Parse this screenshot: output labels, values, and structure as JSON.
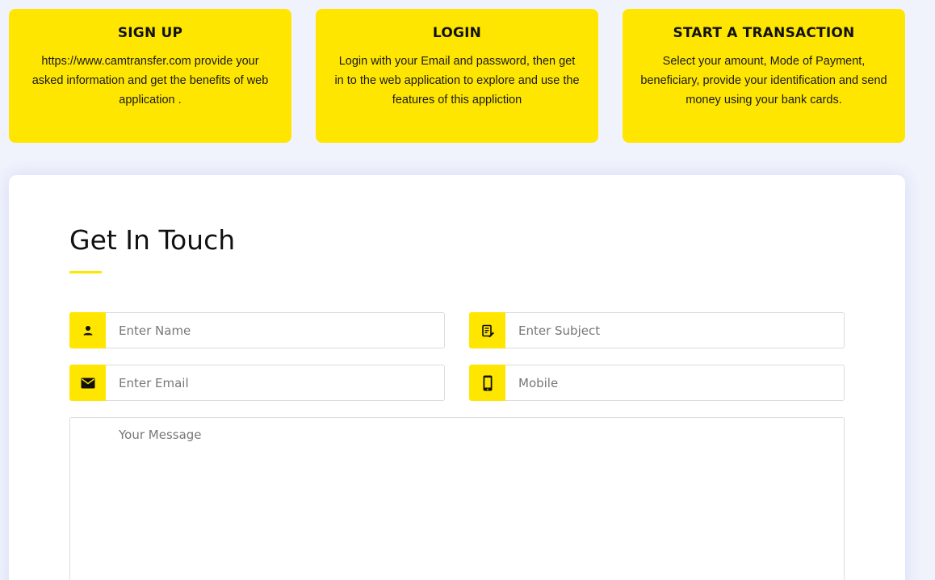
{
  "cards": [
    {
      "title": "SIGN UP",
      "text": "https://www.camtransfer.com provide your asked information and get the benefits of web application ."
    },
    {
      "title": "LOGIN",
      "text": "Login with your Email and password, then get in to the web application to explore and use the features of this appliction"
    },
    {
      "title": "START A TRANSACTION",
      "text": "Select your amount, Mode of Payment, beneficiary, provide your identification and send money using your bank cards."
    }
  ],
  "contact": {
    "title": "Get In Touch",
    "accent_color": "#ffe600",
    "fields": {
      "name": {
        "placeholder": "Enter Name",
        "icon": "user-icon"
      },
      "subject": {
        "placeholder": "Enter Subject",
        "icon": "note-edit-icon"
      },
      "email": {
        "placeholder": "Enter Email",
        "icon": "envelope-icon"
      },
      "mobile": {
        "placeholder": "Mobile",
        "icon": "phone-icon"
      },
      "message": {
        "placeholder": "Your Message"
      }
    }
  }
}
